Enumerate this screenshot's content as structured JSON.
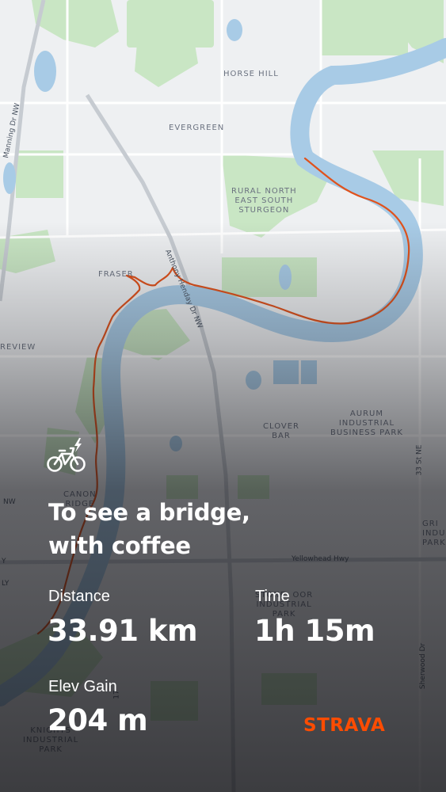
{
  "map": {
    "place_labels": {
      "horse_hill": "HORSE HILL",
      "evergreen": "EVERGREEN",
      "rural_north": "RURAL NORTH\nEAST SOUTH\nSTURGEON",
      "fraser": "FRASER",
      "review": "REVIEW",
      "clover_bar": "CLOVER\nBAR",
      "aurum": "AURUM\nINDUSTRIAL\nBUSINESS PARK",
      "canon_ridge": "CANON\nRIDGE",
      "ind_park_partial": "GRI\nINDUS\nPARK",
      "stoneycroft": "STONE  OOR\nINDUSTRIAL\nPARK",
      "knights": "KNIGHTS\nINDUSTRIAL\nPARK"
    },
    "road_labels": {
      "manning": "Manning Dr NW",
      "anthony": "Anthony Henday Dr NW",
      "yellowhead": "Yellowhead Hwy",
      "st33": "33 St NE",
      "sherwood": "Sherwood Dr",
      "nw": "NW",
      "y": "Y",
      "ly": "LY",
      "d17": "17"
    },
    "colors": {
      "water": "#a8cbe6",
      "park": "#c9e6c4",
      "land": "#eef0f2",
      "route": "#e0521c"
    }
  },
  "activity": {
    "icon": "e-bike-icon",
    "title": "To see a bridge,\nwith coffee"
  },
  "stats": {
    "distance_label": "Distance",
    "distance_value": "33.91 km",
    "time_label": "Time",
    "time_value": "1h 15m",
    "elev_label": "Elev Gain",
    "elev_value": "204 m"
  },
  "brand": {
    "logo_text": "STRAVA",
    "color": "#fc4c02"
  }
}
